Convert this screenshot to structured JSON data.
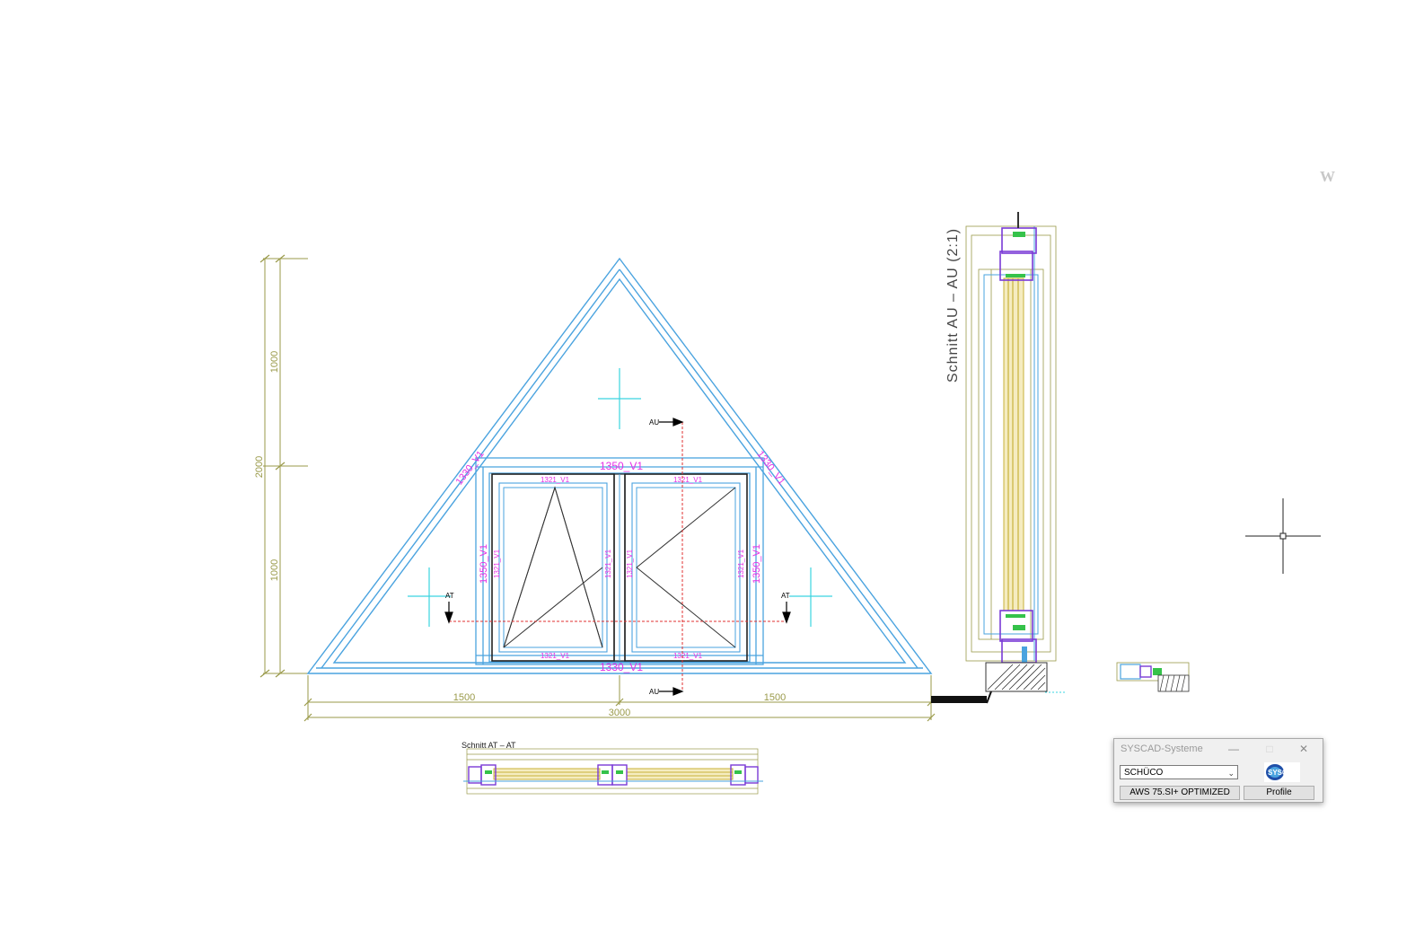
{
  "drawing": {
    "dim_total_height": "2000",
    "dim_upper": "1000",
    "dim_lower": "1000",
    "dim_left_width": "1500",
    "dim_right_width": "1500",
    "dim_total_width": "3000",
    "profile_top_transom": "1350_V1",
    "profile_bottom": "1330_V1",
    "profile_left_side": "1330_V1",
    "profile_right_side": "1330_V1",
    "profile_left_mullion": "1350_V1",
    "profile_right_mullion": "1350_V1",
    "sash_profile": "1321_V1",
    "section_mark_au": "AU",
    "section_mark_at": "AT",
    "section_au_title": "Schnitt  AU  –  AU  (2:1)",
    "section_at_title": "Schnitt  AT  –  AT",
    "watermark_letter": "W"
  },
  "colors": {
    "frame": "#4aa3df",
    "dimension": "#9a9a4a",
    "magenta": "#e62ee6",
    "section_line": "#e03030",
    "cyan": "#3ad4e0",
    "profile_purple": "#7a3ad6",
    "profile_green": "#35c24a",
    "glass_yellow": "#c8b23a"
  },
  "dialog": {
    "title": "SYSCAD-Systeme",
    "minimize": "—",
    "maximize": "□",
    "close": "✕",
    "manufacturer": "SCHÜCO",
    "logo_text": "SYSCAD",
    "system_button": "AWS 75.SI+ OPTIMIZED",
    "profile_button": "Profile"
  }
}
